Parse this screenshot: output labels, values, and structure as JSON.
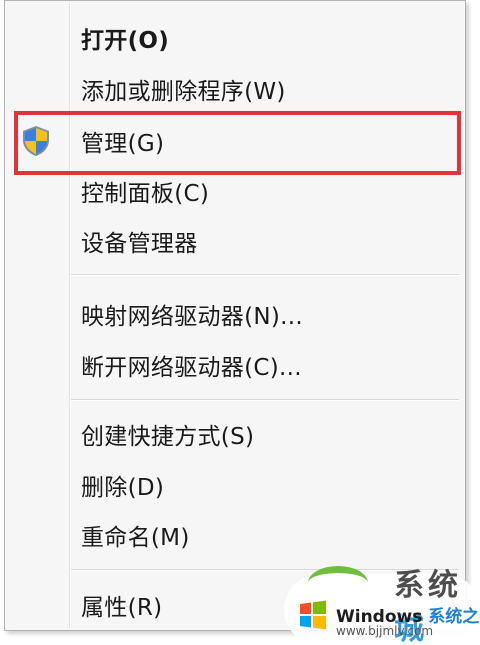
{
  "context_menu": {
    "groups": [
      {
        "items": [
          {
            "label": "打开(O)",
            "bold": true
          },
          {
            "label": "添加或删除程序(W)"
          },
          {
            "label": "管理(G)",
            "icon": "uac-shield-icon",
            "highlighted": true
          },
          {
            "label": "控制面板(C)"
          },
          {
            "label": "设备管理器"
          }
        ]
      },
      {
        "items": [
          {
            "label": "映射网络驱动器(N)..."
          },
          {
            "label": "断开网络驱动器(C)..."
          }
        ]
      },
      {
        "items": [
          {
            "label": "创建快捷方式(S)"
          },
          {
            "label": "删除(D)"
          },
          {
            "label": "重命名(M)"
          }
        ]
      },
      {
        "items": [
          {
            "label": "属性(R)"
          }
        ]
      }
    ]
  },
  "highlight": {
    "color": "#e0343a"
  },
  "watermark": {
    "big_text_prefix": "系统",
    "big_text_accent": "城",
    "brand_en": "Windows",
    "brand_cn": "系统之家",
    "url": "www.bjjmlv.com",
    "logo_icon": "windows-logo-icon"
  }
}
